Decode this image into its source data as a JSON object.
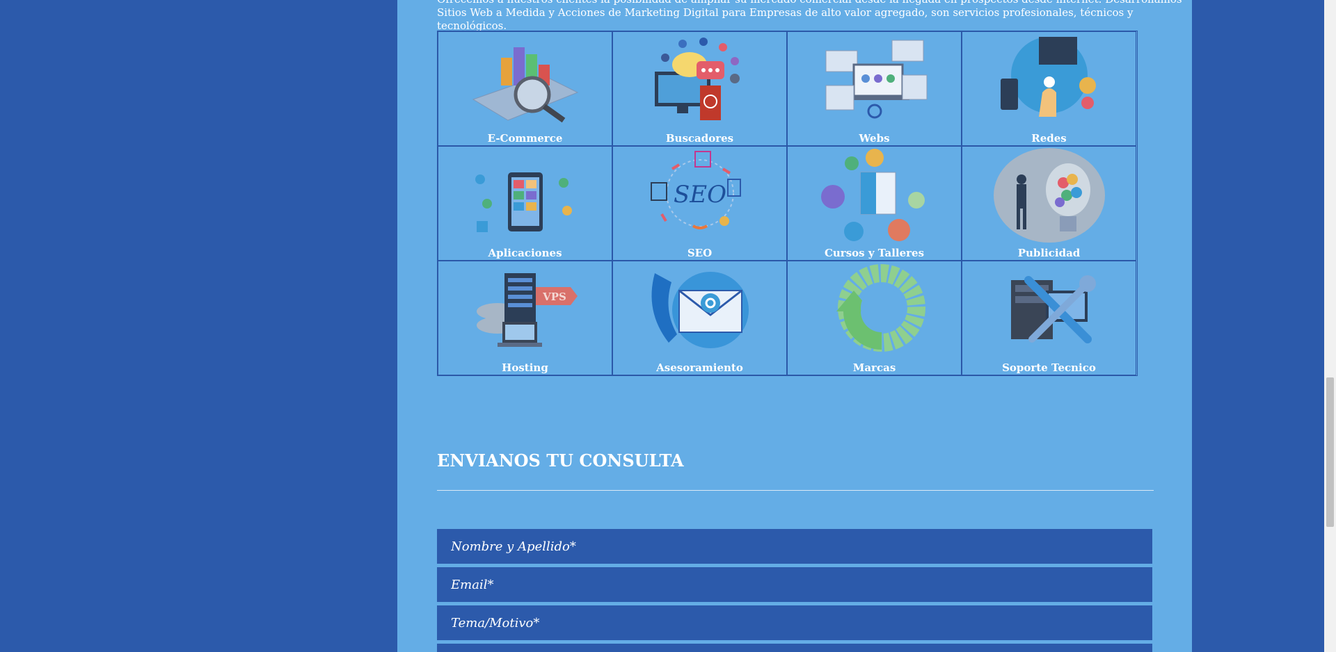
{
  "intro": {
    "text": "Ofrecemos a nuestros clientes la posibilidad de ampliar su mercado comercial desde la llegada en prospectos desde internet. Desarrollamos Sitios Web a Medida y Acciones de Marketing Digital para Empresas de alto valor agregado, son servicios profesionales, técnicos y tecnológicos."
  },
  "services": [
    {
      "label": "E-Commerce",
      "icon": "ecommerce-icon"
    },
    {
      "label": "Buscadores",
      "icon": "search-engines-icon"
    },
    {
      "label": "Webs",
      "icon": "websites-icon"
    },
    {
      "label": "Redes",
      "icon": "networks-icon"
    },
    {
      "label": "Aplicaciones",
      "icon": "apps-icon"
    },
    {
      "label": "SEO",
      "icon": "seo-icon"
    },
    {
      "label": "Cursos y Talleres",
      "icon": "courses-icon"
    },
    {
      "label": "Publicidad",
      "icon": "advertising-icon"
    },
    {
      "label": "Hosting",
      "icon": "hosting-icon"
    },
    {
      "label": "Asesoramiento",
      "icon": "consulting-icon"
    },
    {
      "label": "Marcas",
      "icon": "brands-icon"
    },
    {
      "label": "Soporte Tecnico",
      "icon": "tech-support-icon"
    }
  ],
  "seo_icon_text": "SEO",
  "hosting_badge_text": "VPS",
  "contact": {
    "title": "ENVIANOS TU CONSULTA",
    "name_placeholder": "Nombre y Apellido*",
    "email_placeholder": "Email*",
    "subject_placeholder": "Tema/Motivo*"
  },
  "colors": {
    "page_background": "#2c5aab",
    "content_background": "#64ade6",
    "input_background": "#2c5aab",
    "text": "#ffffff"
  }
}
